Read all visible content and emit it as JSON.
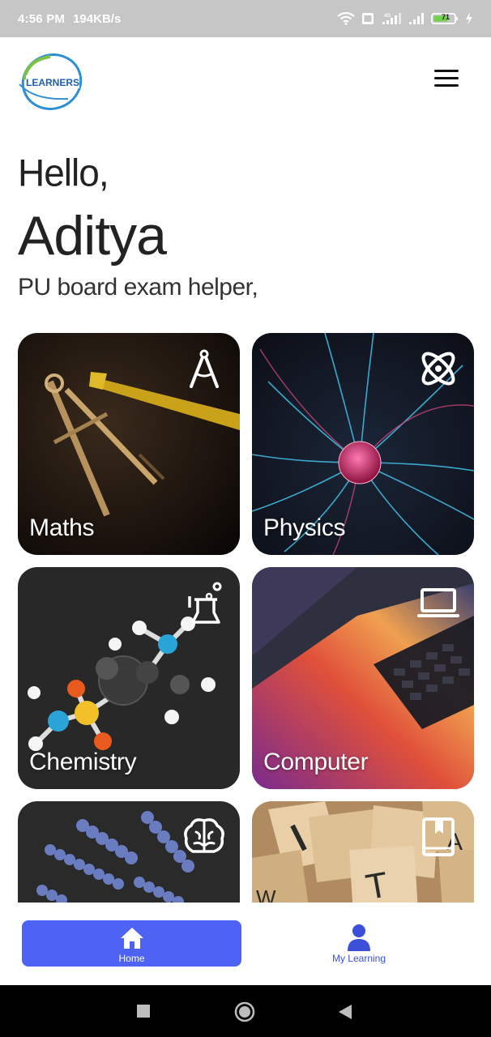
{
  "status_bar": {
    "time": "4:56 PM",
    "speed": "194KB/s",
    "battery": "71"
  },
  "header": {
    "logo_text": "LEARNERS",
    "menu_icon": "hamburger-menu-icon"
  },
  "greeting": {
    "hello": "Hello,",
    "name": "Aditya",
    "subtitle": "PU board exam helper,"
  },
  "subjects": [
    {
      "label": "Maths",
      "icon": "compass-icon"
    },
    {
      "label": "Physics",
      "icon": "atom-icon"
    },
    {
      "label": "Chemistry",
      "icon": "flask-icon"
    },
    {
      "label": "Computer",
      "icon": "laptop-icon"
    },
    {
      "label": "",
      "icon": "brain-icon"
    },
    {
      "label": "",
      "icon": "book-icon"
    }
  ],
  "bottom_nav": {
    "home_label": "Home",
    "my_learning_label": "My Learning",
    "active": "Home"
  },
  "colors": {
    "accent": "#4e62f3",
    "status_bar": "#c6c6c6",
    "card_bg": "#2a2a2a"
  }
}
